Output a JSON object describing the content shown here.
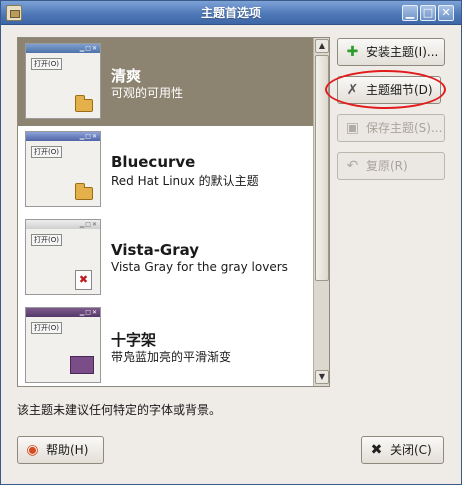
{
  "window": {
    "title": "主题首选项",
    "controls": {
      "minimize": "▁",
      "maximize": "□",
      "close": "✕"
    }
  },
  "themes": [
    {
      "name": "清爽",
      "description": "可观的可用性",
      "selected": true,
      "thumb_open": "打开(O)"
    },
    {
      "name": "Bluecurve",
      "description": "Red Hat Linux 的默认主题",
      "selected": false,
      "thumb_open": "打开(O)"
    },
    {
      "name": "Vista-Gray",
      "description": "Vista Gray for the gray lovers",
      "selected": false,
      "thumb_open": "打开(O)"
    },
    {
      "name": "十字架",
      "description": "带凫蓝加亮的平滑渐变",
      "selected": false,
      "thumb_open": "打开(O)"
    }
  ],
  "buttons": {
    "install": "安装主题(I)...",
    "details": "主题细节(D)",
    "save": "保存主题(S)...",
    "revert": "复原(R)",
    "help": "帮助(H)",
    "close": "关闭(C)"
  },
  "status_text": "该主题未建议任何特定的字体或背景。",
  "icons": {
    "install": "plus-icon",
    "details": "tools-icon",
    "save": "floppy-icon",
    "revert": "undo-icon",
    "help": "lifebuoy-icon",
    "close": "close-icon"
  },
  "colors": {
    "titlebar": "#4f79b8",
    "selected_row": "#8c8371",
    "annotation": "#e01c1c"
  }
}
